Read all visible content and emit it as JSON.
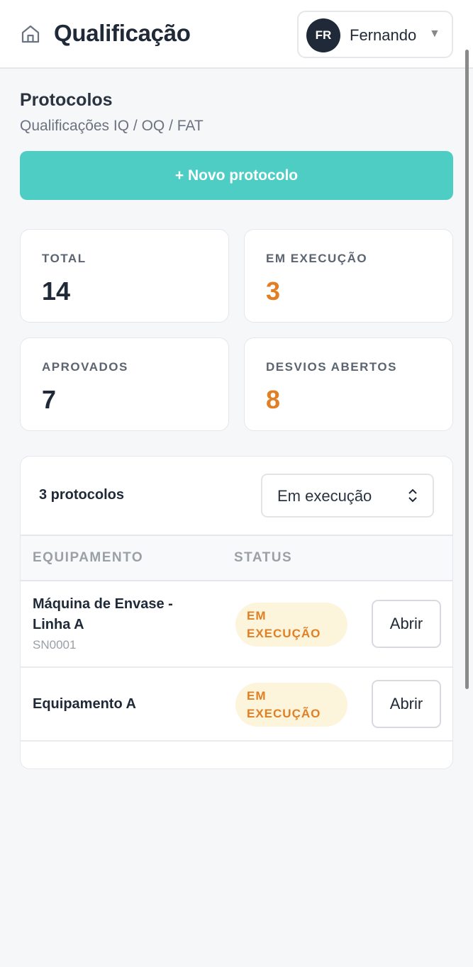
{
  "header": {
    "app_title": "Qualificação",
    "user": {
      "initials": "FR",
      "name": "Fernando"
    }
  },
  "page": {
    "title": "Protocolos",
    "subtitle": "Qualificações IQ / OQ / FAT",
    "new_button_label": "+ Novo protocolo"
  },
  "stats": [
    {
      "label": "TOTAL",
      "value": "14"
    },
    {
      "label": "EM EXECUÇÃO",
      "value": "3"
    },
    {
      "label": "APROVADOS",
      "value": "7"
    },
    {
      "label": "DESVIOS ABERTOS",
      "value": "8"
    }
  ],
  "table": {
    "count_label": "3 protocolos",
    "filter_value": "Em execução",
    "columns": [
      "EQUIPAMENTO",
      "STATUS"
    ],
    "rows": [
      {
        "name": "Máquina de Envase - Linha A",
        "serial": "SN0001",
        "status_line1": "EM",
        "status_line2": "EXECUÇÃO",
        "action": "Abrir"
      },
      {
        "name": "Equipamento A",
        "serial": "",
        "status_line1": "EM",
        "status_line2": "EXECUÇÃO",
        "action": "Abrir"
      }
    ]
  },
  "colors": {
    "accent": "#4ecdc4",
    "warning": "#e07f24",
    "badge_bg": "#fdf4dc",
    "dark": "#1f2937"
  }
}
